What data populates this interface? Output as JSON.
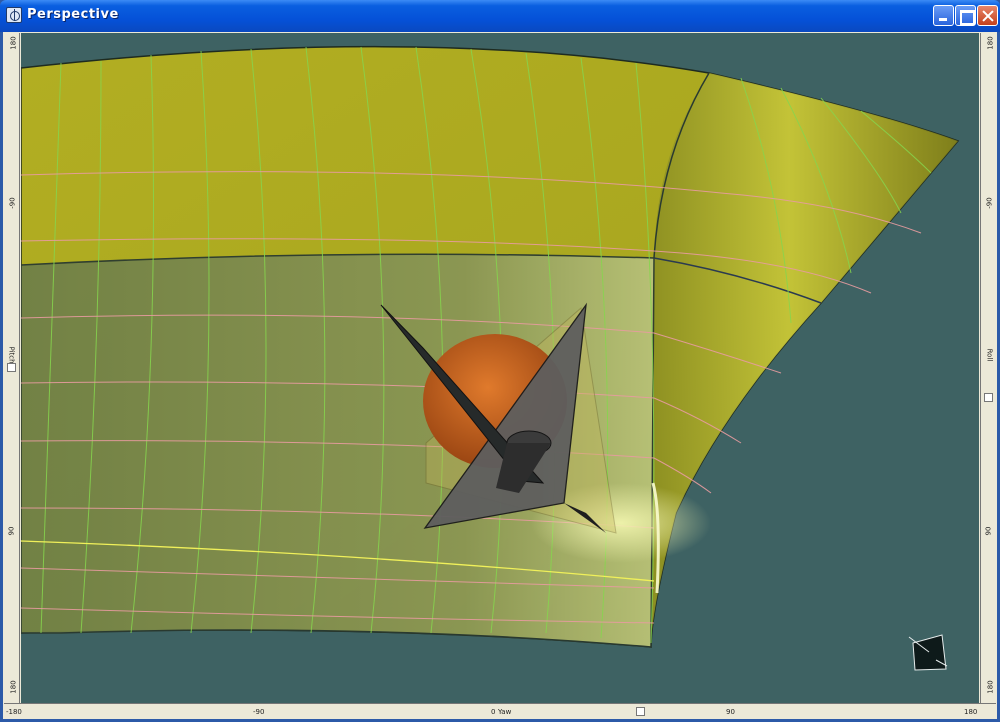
{
  "window": {
    "title": "Perspective"
  },
  "icons": {
    "app": "perspective-app-icon",
    "minimize": "minimize-icon",
    "maximize": "maximize-icon",
    "close": "close-icon",
    "view_cube": "view-orientation-cube-icon"
  },
  "rulers": {
    "left": {
      "axis_name": "Pitch",
      "labels": [
        "180",
        "-90",
        "0",
        "90",
        "180"
      ]
    },
    "right": {
      "axis_name": "Roll",
      "labels": [
        "180",
        "-90",
        "0",
        "90",
        "180"
      ]
    },
    "bottom": {
      "axis_name": "Yaw",
      "labels": [
        "-180",
        "-90",
        "0",
        "90",
        "180"
      ]
    }
  },
  "colors": {
    "title_bar": "#0551d8",
    "viewport_background": "#3e6263",
    "surface_yellow": "#b9b628",
    "surface_yellow_dark": "#8a8a1c",
    "inner_panel": "#7d8a4a",
    "green_grid": "#7fd64a",
    "pink_grid": "#e79a9a",
    "sphere_orange": "#c8601c",
    "plate_grey": "#5c5c5c"
  }
}
